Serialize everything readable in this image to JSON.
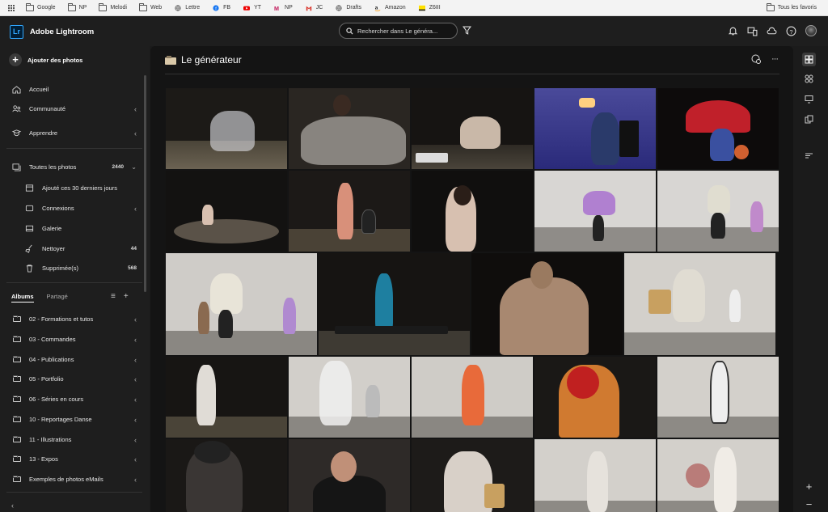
{
  "bookmarks": [
    {
      "label": "Google",
      "icon": "folder-icon"
    },
    {
      "label": "NP",
      "icon": "folder-icon"
    },
    {
      "label": "Melodi",
      "icon": "folder-icon"
    },
    {
      "label": "Web",
      "icon": "folder-icon"
    },
    {
      "label": "Lettre",
      "icon": "globe-icon"
    },
    {
      "label": "FB",
      "icon": "facebook-icon"
    },
    {
      "label": "YT",
      "icon": "youtube-icon"
    },
    {
      "label": "NP",
      "icon": "medium-icon"
    },
    {
      "label": "JC",
      "icon": "gmail-icon"
    },
    {
      "label": "Drafts",
      "icon": "globe-icon"
    },
    {
      "label": "Amazon",
      "icon": "amazon-icon"
    },
    {
      "label": "Z6III",
      "icon": "nikon-icon"
    }
  ],
  "bookmarks_all": "Tous les favoris",
  "app": {
    "logo": "Lr",
    "title": "Adobe Lightroom"
  },
  "search": {
    "placeholder": "Rechercher dans Le généra..."
  },
  "sidebar": {
    "add_photos": "Ajouter des photos",
    "nav": [
      {
        "label": "Accueil",
        "icon": "home-icon"
      },
      {
        "label": "Communauté",
        "icon": "community-icon"
      },
      {
        "label": "Apprendre",
        "icon": "learn-icon"
      }
    ],
    "all_photos": {
      "label": "Toutes les photos",
      "count": "2440"
    },
    "sub": [
      {
        "label": "Ajouté ces 30 derniers jours",
        "icon": "calendar-icon",
        "count": ""
      },
      {
        "label": "Connexions",
        "icon": "connections-icon",
        "count": ""
      },
      {
        "label": "Galerie",
        "icon": "gallery-icon",
        "count": ""
      },
      {
        "label": "Nettoyer",
        "icon": "broom-icon",
        "count": "44"
      },
      {
        "label": "Supprimée(s)",
        "icon": "trash-icon",
        "count": "568"
      }
    ],
    "tabs": {
      "albums": "Albums",
      "shared": "Partagé"
    },
    "albums": [
      "02 - Formations et tutos",
      "03 - Commandes",
      "04 - Publications",
      "05 - Portfolio",
      "06 - Séries en cours",
      "10 - Reportages Danse",
      "11 - Illustrations",
      "13 - Expos",
      "Exemples de photos eMails"
    ]
  },
  "main": {
    "title": "Le générateur"
  },
  "colors": {
    "accent": "#31a8ff",
    "bg": "#141414",
    "panel": "#1e1e1e"
  }
}
